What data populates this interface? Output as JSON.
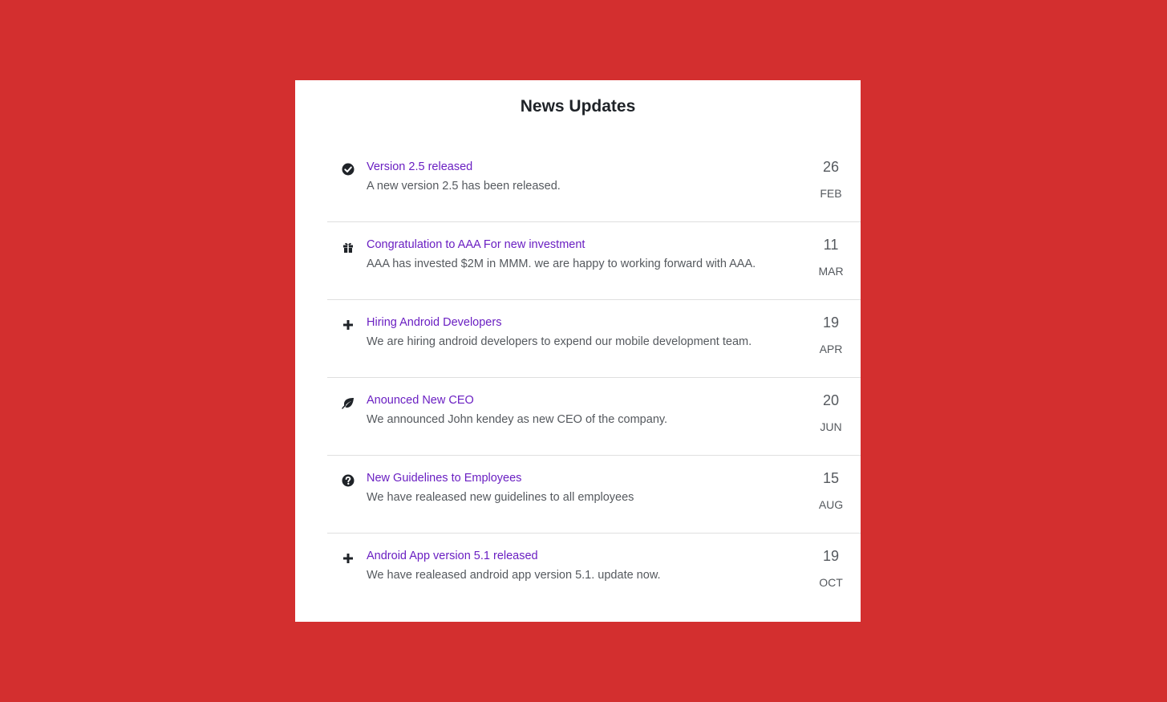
{
  "panel": {
    "title": "News Updates"
  },
  "news": [
    {
      "icon": "check-circle-icon",
      "title": "Version 2.5 released",
      "description": "A new version 2.5 has been released.",
      "day": "26",
      "month": "FEB"
    },
    {
      "icon": "gift-icon",
      "title": "Congratulation to AAA For new investment",
      "description": "AAA has invested $2M in MMM. we are happy to working forward with AAA.",
      "day": "11",
      "month": "MAR"
    },
    {
      "icon": "plus-icon",
      "title": "Hiring Android Developers",
      "description": "We are hiring android developers to expend our mobile development team.",
      "day": "19",
      "month": "APR"
    },
    {
      "icon": "leaf-icon",
      "title": "Anounced New CEO",
      "description": "We announced John kendey as new CEO of the company.",
      "day": "20",
      "month": "JUN"
    },
    {
      "icon": "question-circle-icon",
      "title": "New Guidelines to Employees",
      "description": "We have realeased new guidelines to all employees",
      "day": "15",
      "month": "AUG"
    },
    {
      "icon": "plus-icon",
      "title": "Android App version 5.1 released",
      "description": "We have realeased android app version 5.1. update now.",
      "day": "19",
      "month": "OCT"
    }
  ],
  "colors": {
    "background": "#d32f2f",
    "card": "#ffffff",
    "link": "#6a1fc2",
    "text": "#55595e",
    "title": "#1f2328"
  }
}
